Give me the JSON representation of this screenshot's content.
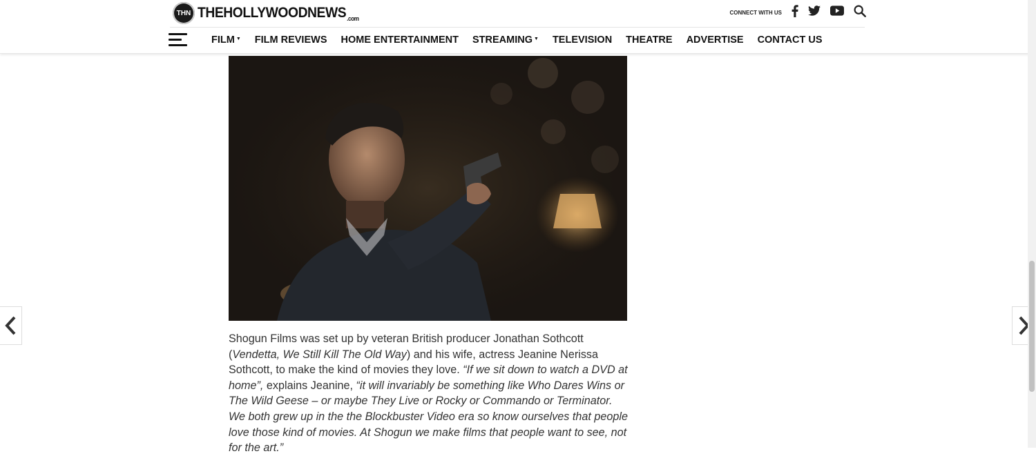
{
  "site": {
    "logo_mark": "THN",
    "logo_text": "THEHOLLYWOODNEWS",
    "logo_tld": ".com",
    "connect_label": "CONNECT WITH US",
    "social_icons": [
      "facebook-icon",
      "twitter-icon",
      "youtube-icon",
      "search-icon"
    ]
  },
  "nav": {
    "items": [
      {
        "label": "FILM",
        "has_dropdown": true
      },
      {
        "label": "FILM REVIEWS",
        "has_dropdown": false
      },
      {
        "label": "HOME ENTERTAINMENT",
        "has_dropdown": false
      },
      {
        "label": "STREAMING",
        "has_dropdown": true
      },
      {
        "label": "TELEVISION",
        "has_dropdown": false
      },
      {
        "label": "THEATRE",
        "has_dropdown": false
      },
      {
        "label": "ADVERTISE",
        "has_dropdown": false
      },
      {
        "label": "CONTACT US",
        "has_dropdown": false
      }
    ]
  },
  "article": {
    "p1_a": "Shogun Films was set up by veteran British producer Jonathan Sothcott (",
    "p1_b": "Vendetta, We Still Kill The Old Way",
    "p1_c": ") and his wife, actress Jeanine Nerissa Sothcott, to make the kind of movies they love. ",
    "p1_d": "“If we sit down to watch a DVD at home”,",
    "p1_e": " explains Jeanine, ",
    "p1_f": "“it will invariably be something like Who Dares Wins or The Wild Geese – or maybe They Live or Rocky or Commando or Terminator. We both grew up in the the Blockbuster Video era so know ourselves that people love those kind of movies. At Shogun we make films that people want to see, not for the art.”"
  },
  "colors": {
    "text": "#333333",
    "nav_text": "#111111",
    "hero_dark": "#0f0c0a"
  },
  "arrows": {
    "left_icon": "chevron-left-icon",
    "right_icon": "chevron-right-icon"
  }
}
